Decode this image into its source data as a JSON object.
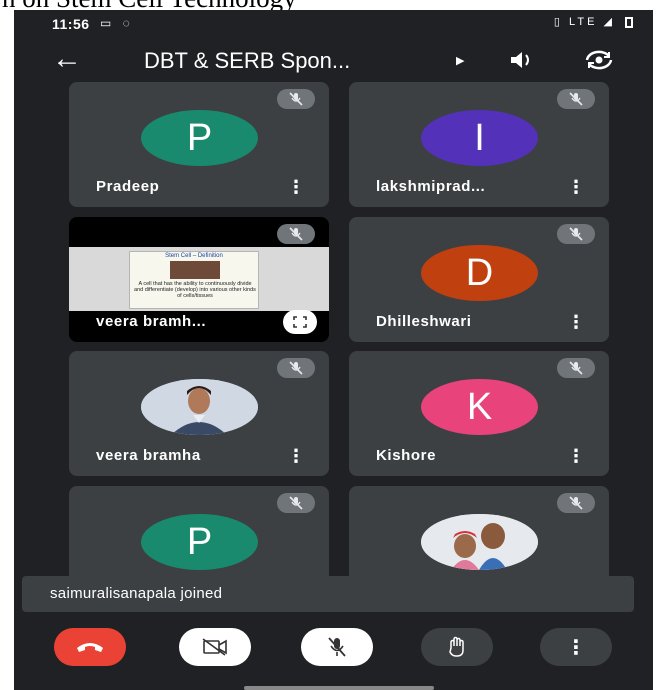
{
  "document": {
    "caption": "n on Stem Cell Technology"
  },
  "status_bar": {
    "time": "11:56",
    "network": "LTE"
  },
  "app_bar": {
    "title": "DBT & SERB Spon..."
  },
  "participants": [
    {
      "name": "Pradeep",
      "initial": "P",
      "avatar_color": "#1a8a6e",
      "muted": true
    },
    {
      "name": "lakshmiprad...",
      "initial": "I",
      "avatar_color": "#5331b8",
      "muted": true
    },
    {
      "name": "veera bramh...",
      "type": "screen_share",
      "muted": true
    },
    {
      "name": "Dhilleshwari",
      "initial": "D",
      "avatar_color": "#c1400f",
      "muted": true
    },
    {
      "name": "veera bramha",
      "type": "photo",
      "muted": true
    },
    {
      "name": "Kishore",
      "initial": "K",
      "avatar_color": "#e8437a",
      "muted": true
    },
    {
      "name": "",
      "initial": "P",
      "avatar_color": "#1a8a6e",
      "muted": true
    },
    {
      "name": "",
      "type": "photo",
      "muted": true
    }
  ],
  "shared_slide": {
    "title": "Stem Cell – Definition",
    "body": "A cell that has the ability to continuously divide and differentiate (develop) into various other kinds of cells/tissues"
  },
  "toast": {
    "message": "saimuralisanapala joined"
  },
  "colors": {
    "end_call": "#ea4335",
    "background": "#202124",
    "tile": "#3c4043"
  }
}
